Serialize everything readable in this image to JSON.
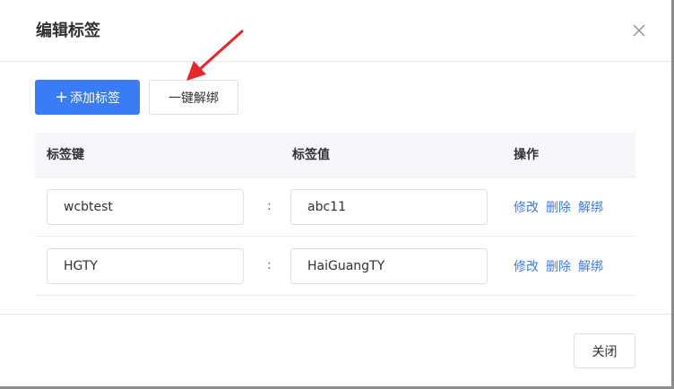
{
  "dialog": {
    "title": "编辑标签",
    "close_icon": "close-icon"
  },
  "toolbar": {
    "add_icon": "+",
    "add_label": "添加标签",
    "unbind_all_label": "一键解绑"
  },
  "table": {
    "headers": {
      "key": "标签键",
      "value": "标签值",
      "actions": "操作"
    },
    "separator": ":",
    "rows": [
      {
        "key": "wcbtest",
        "value": "abc11",
        "edit": "修改",
        "delete": "删除",
        "unbind": "解绑"
      },
      {
        "key": "HGTY",
        "value": "HaiGuangTY",
        "edit": "修改",
        "delete": "删除",
        "unbind": "解绑"
      }
    ]
  },
  "footer": {
    "close_label": "关闭"
  },
  "colors": {
    "primary": "#3a7cf5",
    "annotation_arrow": "#e8262a"
  }
}
